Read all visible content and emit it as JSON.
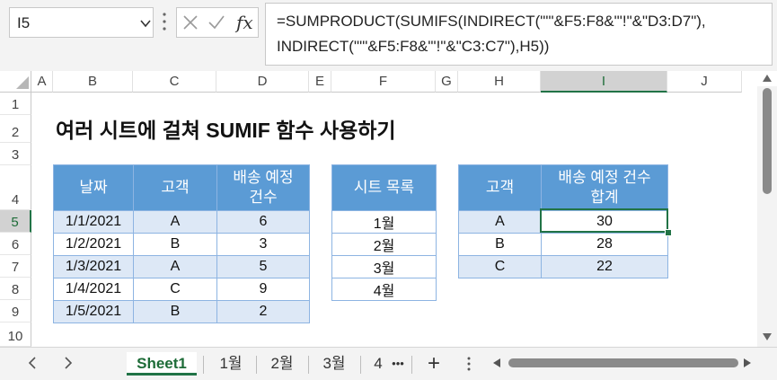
{
  "formula_bar": {
    "name_box": "I5",
    "formula": "=SUMPRODUCT(SUMIFS(INDIRECT(\"'\"&F5:F8&\"'!\"&\"D3:D7\"),\nINDIRECT(\"'\"&F5:F8&\"'!\"&\"C3:C7\"),H5))",
    "fx_label": "fx"
  },
  "columns": [
    "A",
    "B",
    "C",
    "D",
    "E",
    "F",
    "G",
    "H",
    "I",
    "J"
  ],
  "rows": [
    "1",
    "2",
    "3",
    "4",
    "5",
    "6",
    "7",
    "8",
    "9",
    "10"
  ],
  "selected_cell": {
    "column": "I",
    "row": "5"
  },
  "sheet": {
    "title": "여러 시트에 걸쳐 SUMIF 함수 사용하기",
    "table1": {
      "headers": [
        "날짜",
        "고객",
        "배송 예정\n건수"
      ],
      "rows": [
        [
          "1/1/2021",
          "A",
          "6"
        ],
        [
          "1/2/2021",
          "B",
          "3"
        ],
        [
          "1/3/2021",
          "A",
          "5"
        ],
        [
          "1/4/2021",
          "C",
          "9"
        ],
        [
          "1/5/2021",
          "B",
          "2"
        ]
      ]
    },
    "table2": {
      "header": "시트 목록",
      "rows": [
        "1월",
        "2월",
        "3월",
        "4월"
      ]
    },
    "table3": {
      "headers": [
        "고객",
        "배송 예정 건수\n합계"
      ],
      "rows": [
        [
          "A",
          "30"
        ],
        [
          "B",
          "28"
        ],
        [
          "C",
          "22"
        ]
      ]
    }
  },
  "tabs": {
    "items": [
      "Sheet1",
      "1월",
      "2월",
      "3월",
      "4"
    ],
    "active": "Sheet1",
    "more": "•••",
    "add": "+"
  },
  "colors": {
    "accent": "#217346",
    "table_header": "#5b9bd5",
    "table_band": "#dde8f6",
    "table_border": "#8db4e2"
  }
}
